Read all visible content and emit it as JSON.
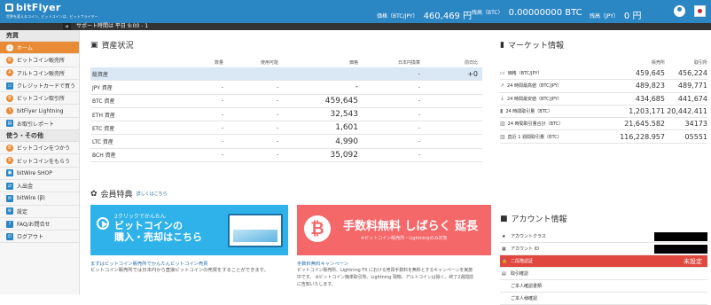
{
  "brand": {
    "name": "bitFlyer",
    "tagline": "世界を変えるコイン、ビットコインは、ビットフライヤー"
  },
  "header": {
    "price_label": "価格（BTC/JPY）",
    "price_value": "460,469 円",
    "btc_label": "残高（BTC）",
    "btc_value": "0.00000000 BTC",
    "jpy_label": "残高（JPY）",
    "jpy_value": "0 円"
  },
  "subbar": {
    "toggle": "«",
    "ticker": "サポート時間は 平日 9:00 - 1"
  },
  "sidebar": {
    "section1": "売買",
    "items1": [
      {
        "label": "ホーム",
        "icon": "home-icon",
        "glyph": "⌂"
      },
      {
        "label": "ビットコイン販売所",
        "icon": "bitcoin-icon",
        "glyph": "B"
      },
      {
        "label": "アルトコイン販売所",
        "icon": "altcoin-icon",
        "glyph": "A"
      },
      {
        "label": "クレジットカードで買う",
        "icon": "credit-card-icon",
        "glyph": "▭"
      },
      {
        "label": "ビットコイン取引所",
        "icon": "exchange-icon",
        "glyph": "B"
      },
      {
        "label": "bitFlyer Lightning",
        "icon": "lightning-icon",
        "glyph": "ϟ"
      },
      {
        "label": "お取引レポート",
        "icon": "report-icon",
        "glyph": "▤"
      }
    ],
    "section2": "使う・その他",
    "items2": [
      {
        "label": "ビットコインをつかう",
        "icon": "use-bitcoin-icon",
        "glyph": "B"
      },
      {
        "label": "ビットコインをもらう",
        "icon": "receive-bitcoin-icon",
        "glyph": "B"
      },
      {
        "label": "bitWire SHOP",
        "icon": "shop-icon",
        "glyph": "▣"
      },
      {
        "label": "入出金",
        "icon": "deposit-icon",
        "glyph": "⇄"
      },
      {
        "label": "bitWire (β)",
        "icon": "bitwire-icon",
        "glyph": "✉"
      },
      {
        "label": "設定",
        "icon": "settings-icon",
        "glyph": "⚙"
      },
      {
        "label": "FAQ/お問合せ",
        "icon": "faq-icon",
        "glyph": "?"
      },
      {
        "label": "ログアウト",
        "icon": "logout-icon",
        "glyph": "⏻"
      }
    ]
  },
  "assets": {
    "title": "資産状況",
    "columns": [
      "数量",
      "使用可能",
      "価格",
      "日本円換算",
      "前日比"
    ],
    "rows": [
      {
        "name": "総資産",
        "qty": "",
        "avail": "",
        "price": "",
        "jpy": "-",
        "diff": "+0"
      },
      {
        "name": "JPY 資産",
        "qty": "-",
        "avail": "-",
        "price": "-",
        "jpy": "-",
        "diff": ""
      },
      {
        "name": "BTC 資産",
        "qty": "-",
        "avail": "-",
        "price": "459,645",
        "jpy": "-",
        "diff": ""
      },
      {
        "name": "ETH 資産",
        "qty": "-",
        "avail": "-",
        "price": "32,543",
        "jpy": "-",
        "diff": ""
      },
      {
        "name": "ETC 資産",
        "qty": "-",
        "avail": "-",
        "price": "1,601",
        "jpy": "-",
        "diff": ""
      },
      {
        "name": "LTC 資産",
        "qty": "-",
        "avail": "-",
        "price": "4,990",
        "jpy": "-",
        "diff": ""
      },
      {
        "name": "BCH 資産",
        "qty": "-",
        "avail": "-",
        "price": "35,092",
        "jpy": "-",
        "diff": ""
      }
    ]
  },
  "member": {
    "title": "会員特典",
    "link": "詳しくはこちら",
    "banner1": {
      "small": "2クリックでかんたん",
      "big1": "ビットコインの",
      "big2": "購入・売却はこちら"
    },
    "banner2": {
      "big": "手数料無料 しばらく 延長",
      "small": "※ビットコイン販売所・Lightningのみ対象"
    },
    "caption1": "まずはビットコイン販売所でかんたんビットコイン売買",
    "desc1": "ビットコイン販売所では日本円から直接ビットコインの売買をすることができます。",
    "caption2": "手数料無料キャンペーン",
    "desc2a": "ビットコイン販売所、Lightning FX における売買手数料を無料とするキャンペーンを実施",
    "desc2b": "中です。 ※ビットコイン簡単取引所、Lightning 現物、アルトコインは除く。終了2週間前",
    "desc2c": "に告知いたします。"
  },
  "market": {
    "title": "マーケット情報",
    "col1": "販売所",
    "col2": "取引所",
    "rows": [
      {
        "label": "価格（BTC/JPY）",
        "glyph": "▭",
        "v1": "459,645",
        "v2": "456,224"
      },
      {
        "label": "24 時間最高値（BTC/JPY）",
        "glyph": "↗",
        "v1": "489,823",
        "v2": "489,771"
      },
      {
        "label": "24 時間最安値（BTC/JPY）",
        "glyph": "↓",
        "v1": "434,685",
        "v2": "441,674"
      },
      {
        "label": "24 時間取引量（BTC）",
        "glyph": "▮",
        "v1": "1,203,171",
        "v2": "20,442.411"
      },
      {
        "label": "24 時間取引量合計（BTC）",
        "glyph": "▥",
        "v1": "21,645.582",
        "v2": "34173"
      },
      {
        "label": "直近 1 週間取引量（BTC）",
        "glyph": "▥",
        "v1": "116,228.957",
        "v2": "05551"
      }
    ]
  },
  "account": {
    "title": "アカウント情報",
    "rows": [
      {
        "label": "アカウントクラス",
        "glyph": "★"
      },
      {
        "label": "アカウント ID",
        "glyph": "▦"
      },
      {
        "label": "二段階認証",
        "glyph": "🔒",
        "status": "未設定"
      },
      {
        "label": "取引確認",
        "glyph": "▤"
      },
      {
        "label": "ご本人確認書類",
        "glyph": ""
      },
      {
        "label": "ご本人様確認",
        "glyph": ""
      }
    ]
  }
}
